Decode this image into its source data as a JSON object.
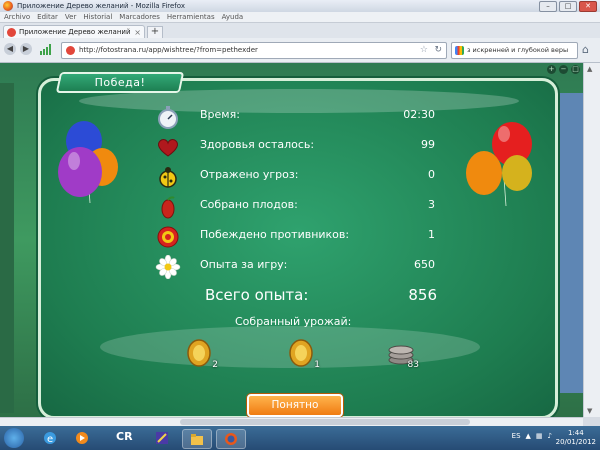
{
  "browser": {
    "window_title": "Приложение Дерево желаний - Mozilla Firefox",
    "window_buttons": [
      "–",
      "□",
      "✕"
    ],
    "menu": [
      "Archivo",
      "Editar",
      "Ver",
      "Historial",
      "Marcadores",
      "Herramientas",
      "Ayuda"
    ],
    "tab_title": "Приложение Дерево желаний",
    "tab_close": "×",
    "new_tab": "+",
    "url": "http://fotostrana.ru/app/wishtree/?from=pethexder",
    "search_text": "з искренней и глубокой веры"
  },
  "dialog": {
    "header": "Победа!",
    "stats": [
      {
        "label": "Время:",
        "value": "02:30",
        "icon": "stopwatch-icon"
      },
      {
        "label": "Здоровья осталось:",
        "value": "99",
        "icon": "heart-icon"
      },
      {
        "label": "Отражено угроз:",
        "value": "0",
        "icon": "beetle-icon"
      },
      {
        "label": "Собрано плодов:",
        "value": "3",
        "icon": "fruit-icon"
      },
      {
        "label": "Побеждено противников:",
        "value": "1",
        "icon": "target-icon"
      },
      {
        "label": "Опыта за игру:",
        "value": "650",
        "icon": "daisy-icon"
      }
    ],
    "total_label": "Всего опыта:",
    "total_value": "856",
    "harvest_title": "Собранный урожай:",
    "harvest": [
      {
        "icon": "gold-coin-icon",
        "count": "2"
      },
      {
        "icon": "gold-coin-icon",
        "count": "1"
      },
      {
        "icon": "silver-coins-icon",
        "count": "83"
      }
    ],
    "ok_button": "Понятно"
  },
  "taskbar": {
    "app_label": "CR",
    "language": "ES",
    "time": "1:44",
    "date": "20/01/2012"
  }
}
